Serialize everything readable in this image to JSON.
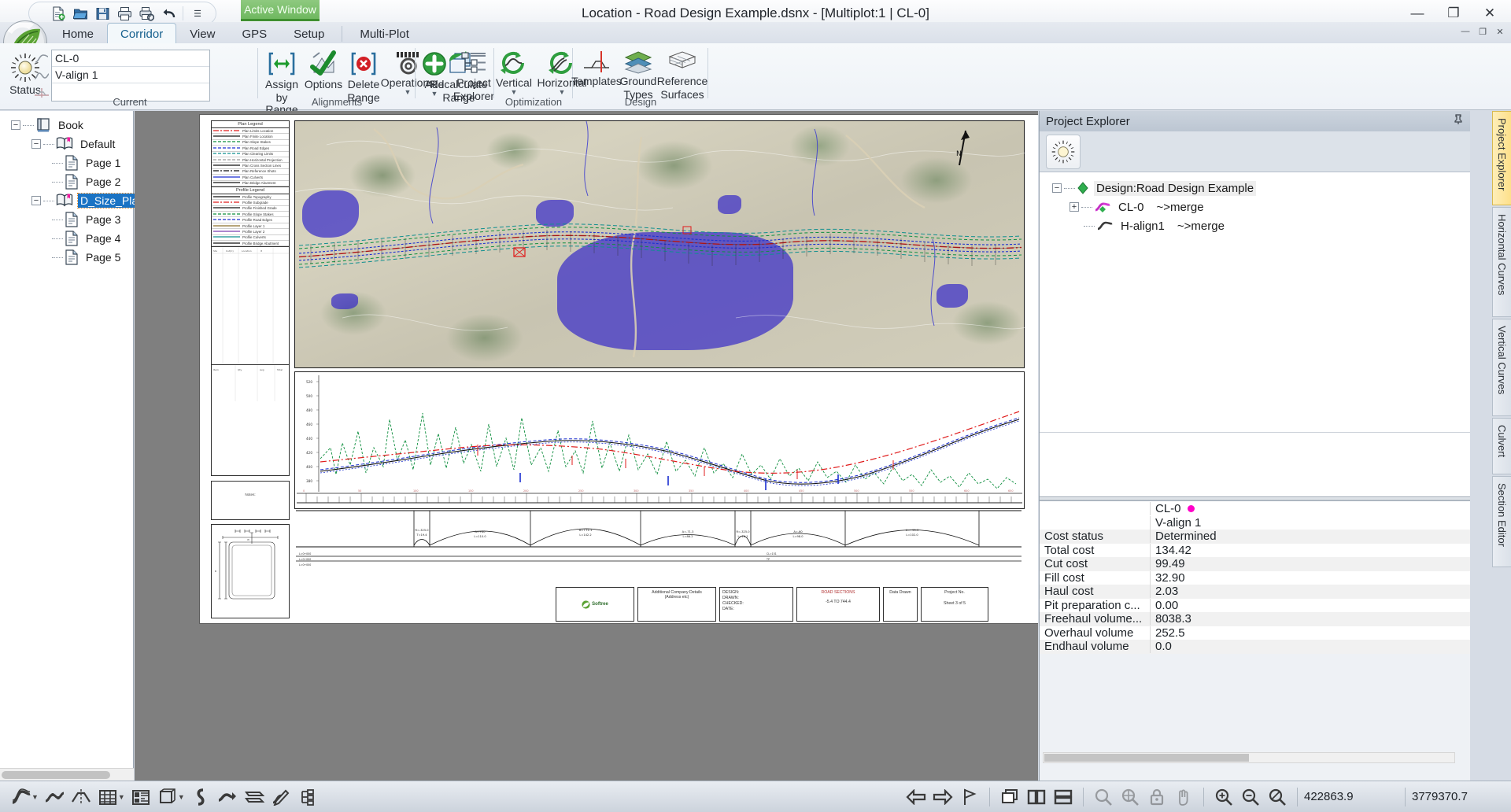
{
  "window": {
    "title": "Location - Road Design Example.dsnx - [Multiplot:1 | CL-0]",
    "active_window_badge": "Active Window",
    "minimize": "—",
    "maximize": "❐",
    "close": "✕",
    "doc_minimize": "—",
    "doc_restore": "❐",
    "doc_close": "✕"
  },
  "quick_access": {
    "items": [
      {
        "name": "new-icon",
        "glyph": "new"
      },
      {
        "name": "open-icon",
        "glyph": "open"
      },
      {
        "name": "save-icon",
        "glyph": "save"
      },
      {
        "name": "print-icon",
        "glyph": "print"
      },
      {
        "name": "print-setup-icon",
        "glyph": "print-setup"
      },
      {
        "name": "undo-icon",
        "glyph": "undo"
      }
    ],
    "overflow": "☰"
  },
  "tabs": [
    {
      "label": "Home",
      "active": false
    },
    {
      "label": "Corridor",
      "active": true
    },
    {
      "label": "View",
      "active": false
    },
    {
      "label": "GPS",
      "active": false
    },
    {
      "label": "Setup",
      "active": false
    },
    {
      "label": "Multi-Plot",
      "active": false
    }
  ],
  "ribbon": {
    "groups": [
      {
        "caption": "Current",
        "status_label": "Status",
        "fields": [
          {
            "name": "centerline-field",
            "value": "CL-0"
          },
          {
            "name": "valign-field",
            "value": "V-align 1"
          },
          {
            "name": "third-field",
            "value": ""
          }
        ]
      },
      {
        "caption": "Alignments",
        "buttons": [
          {
            "name": "assign-by-range-button",
            "line1": "Assign",
            "line2": "by Range",
            "icon": "assign-range-icon",
            "caret": false
          },
          {
            "name": "options-button",
            "line1": "Options",
            "line2": "",
            "icon": "options-check-icon",
            "caret": false
          },
          {
            "name": "delete-range-button",
            "line1": "Delete",
            "line2": "Range",
            "icon": "delete-range-icon",
            "caret": false
          },
          {
            "name": "operations-button",
            "line1": "Operations",
            "line2": "",
            "icon": "operations-gear-icon",
            "caret": true
          },
          {
            "name": "recalculate-range-button",
            "line1": "Recalculate",
            "line2": "Range",
            "icon": "recalculate-icon",
            "caret": false
          }
        ]
      },
      {
        "caption": "",
        "buttons": [
          {
            "name": "add-button",
            "line1": "Add",
            "line2": "",
            "icon": "add-plus-icon",
            "caret": true
          },
          {
            "name": "project-explorer-button",
            "line1": "Project",
            "line2": "Explorer",
            "icon": "project-explorer-icon",
            "caret": false
          }
        ]
      },
      {
        "caption": "Optimization",
        "buttons": [
          {
            "name": "vertical-optimize-button",
            "line1": "Vertical",
            "line2": "",
            "icon": "vertical-optimize-icon",
            "caret": true
          },
          {
            "name": "horizontal-optimize-button",
            "line1": "Horizontal",
            "line2": "",
            "icon": "horizontal-optimize-icon",
            "caret": true
          }
        ]
      },
      {
        "caption": "Design",
        "buttons": [
          {
            "name": "templates-button",
            "line1": "Templates",
            "line2": "",
            "icon": "templates-icon",
            "caret": false
          },
          {
            "name": "ground-types-button",
            "line1": "Ground",
            "line2": "Types",
            "icon": "ground-types-icon",
            "caret": false
          },
          {
            "name": "reference-surfaces-button",
            "line1": "Reference",
            "line2": "Surfaces",
            "icon": "reference-surfaces-icon",
            "caret": false
          }
        ]
      }
    ]
  },
  "tree": {
    "nodes": [
      {
        "label": "Book",
        "depth": 0,
        "icon": "book-icon",
        "expander": "−",
        "selected": false
      },
      {
        "label": "Default",
        "depth": 1,
        "icon": "open-book-icon",
        "expander": "−",
        "selected": false
      },
      {
        "label": "Page 1",
        "depth": 2,
        "icon": "page-icon",
        "expander": "",
        "selected": false
      },
      {
        "label": "Page 2",
        "depth": 2,
        "icon": "page-icon",
        "expander": "",
        "selected": false
      },
      {
        "label": "D_Size_Plan_Profi",
        "depth": 1,
        "icon": "open-book-icon",
        "expander": "−",
        "selected": true
      },
      {
        "label": "Page 3",
        "depth": 2,
        "icon": "page-icon",
        "expander": "",
        "selected": false
      },
      {
        "label": "Page 4",
        "depth": 2,
        "icon": "page-icon",
        "expander": "",
        "selected": false
      },
      {
        "label": "Page 5",
        "depth": 2,
        "icon": "page-icon",
        "expander": "",
        "selected": false
      }
    ]
  },
  "project_explorer": {
    "title": "Project Explorer",
    "pin_icon": "pin-icon",
    "sun_button": "sun-icon",
    "nodes": [
      {
        "label": "Design:Road Design Example",
        "depth": 0,
        "icon": "design-diamond-icon",
        "expander": "−",
        "selected": true,
        "suffix": ""
      },
      {
        "label": "CL-0",
        "depth": 1,
        "icon": "centerline-icon",
        "expander": "+",
        "selected": false,
        "suffix": "~>merge"
      },
      {
        "label": "H-align1",
        "depth": 1,
        "icon": "halign-icon",
        "expander": "",
        "selected": false,
        "suffix": "~>merge"
      }
    ]
  },
  "cost_table": {
    "header": {
      "col1": "",
      "col2_line1": "CL-0",
      "col2_line2": "V-align 1",
      "marker_color": "#ff00c8"
    },
    "rows": [
      {
        "key": "Cost status",
        "value": "Determined"
      },
      {
        "key": "Total cost",
        "value": "134.42"
      },
      {
        "key": "Cut cost",
        "value": "99.49"
      },
      {
        "key": "Fill cost",
        "value": "32.90"
      },
      {
        "key": "Haul cost",
        "value": "2.03"
      },
      {
        "key": "Pit preparation c...",
        "value": "0.00"
      },
      {
        "key": "Freehaul volume...",
        "value": "8038.3"
      },
      {
        "key": "Overhaul volume",
        "value": "252.5"
      },
      {
        "key": "Endhaul volume",
        "value": "0.0"
      }
    ]
  },
  "vertical_tabs": [
    {
      "label": "Project Explorer",
      "active": true
    },
    {
      "label": "Horizontal Curves",
      "active": false
    },
    {
      "label": "Vertical Curves",
      "active": false
    },
    {
      "label": "Culvert",
      "active": false
    },
    {
      "label": "Section Editor",
      "active": false
    }
  ],
  "drawing": {
    "plan_legend_title": "Plan Legend",
    "plan_legend_items": [
      {
        "label": "Plan Limits Location",
        "color": "#e01b1b",
        "style": "dashdot"
      },
      {
        "label": "Plan Finite Location",
        "color": "#111111",
        "style": "solid"
      },
      {
        "label": "Plan Slope Stakes",
        "color": "#0f8f3f",
        "style": "dashed"
      },
      {
        "label": "Plan Road Edges",
        "color": "#1b2fd0",
        "style": "dashed"
      },
      {
        "label": "Plan Clearing Limits",
        "color": "#0f8f8f",
        "style": "dashed"
      },
      {
        "label": "Plan Horizontal Projection",
        "color": "#999999",
        "style": "dashed"
      },
      {
        "label": "Plan Cross Section Lines",
        "color": "#111111",
        "style": "solid"
      },
      {
        "label": "Plan Reference Shots",
        "color": "#111111",
        "style": "dashdot"
      },
      {
        "label": "Plan Culverts",
        "color": "#1b2fd0",
        "style": "solid"
      },
      {
        "label": "Plan Bridge Abutment",
        "color": "#111111",
        "style": "solid"
      }
    ],
    "profile_legend_title": "Profile Legend",
    "profile_legend_items": [
      {
        "label": "Profile Topography",
        "color": "#111111",
        "style": "solid"
      },
      {
        "label": "Profile Subgrade",
        "color": "#e01b1b",
        "style": "dashdot"
      },
      {
        "label": "Profile Finished Grade",
        "color": "#111111",
        "style": "solid"
      },
      {
        "label": "Profile Slope Stakes",
        "color": "#0f8f3f",
        "style": "dashed"
      },
      {
        "label": "Profile Road Edges",
        "color": "#1b2fd0",
        "style": "dashed"
      },
      {
        "label": "Profile Layer 1",
        "color": "#8a6f2a",
        "style": "solid"
      },
      {
        "label": "Profile Layer 2",
        "color": "#7a3fb0",
        "style": "solid"
      },
      {
        "label": "Profile Culverts",
        "color": "#0f8f8f",
        "style": "solid"
      },
      {
        "label": "Profile Bridge Abutment",
        "color": "#111111",
        "style": "solid"
      }
    ],
    "notes_label": "Notes:",
    "titleblocks": [
      {
        "name": "logo-block",
        "lines": [
          "Softree"
        ]
      },
      {
        "name": "company-block",
        "lines": [
          "Additional Company Details",
          "(Address etc)"
        ]
      },
      {
        "name": "signoff-block",
        "lines": [
          "DESIGN:",
          "DRAWN:",
          "CHECKED:",
          "DATE:"
        ]
      },
      {
        "name": "sections-block",
        "lines": [
          "ROAD SECTIONS",
          "-5.4      TO     744.4"
        ]
      },
      {
        "name": "datadrawn-block",
        "lines": [
          "Data Drawn"
        ]
      },
      {
        "name": "sheet-block",
        "lines": [
          "Project No.",
          "Sheet 3 of 5"
        ]
      }
    ],
    "station_from": "-5.4",
    "station_to": "744.4",
    "sheet_label": "Sheet 3 of 5",
    "north_arrow": "north-arrow-icon"
  },
  "statusbar": {
    "left_tools": [
      {
        "name": "alignment-tool",
        "icon": "alignment-curve-icon",
        "caret": true,
        "disabled": false
      },
      {
        "name": "profile-tool",
        "icon": "profile-curve-icon",
        "caret": false,
        "disabled": false
      },
      {
        "name": "cross-section-tool",
        "icon": "cross-section-icon",
        "caret": false,
        "disabled": false
      },
      {
        "name": "table-tool",
        "icon": "table-grid-icon",
        "caret": true,
        "disabled": false
      },
      {
        "name": "report-tool",
        "icon": "report-layout-icon",
        "caret": false,
        "disabled": false
      },
      {
        "name": "3d-view-tool",
        "icon": "cube-3d-icon",
        "caret": true,
        "disabled": false
      },
      {
        "name": "insert-pi-tool",
        "icon": "insert-pi-icon",
        "caret": false,
        "disabled": false
      },
      {
        "name": "move-pi-tool",
        "icon": "move-pi-icon",
        "caret": false,
        "disabled": false
      },
      {
        "name": "offset-tool",
        "icon": "offset-icon",
        "caret": false,
        "disabled": false
      },
      {
        "name": "edit-alignment-tool",
        "icon": "edit-alignment-icon",
        "caret": false,
        "disabled": false
      },
      {
        "name": "hierarchy-tool",
        "icon": "hierarchy-icon",
        "caret": false,
        "disabled": false
      }
    ],
    "right_tools": [
      {
        "name": "previous-button",
        "icon": "arrow-left-icon",
        "disabled": false
      },
      {
        "name": "next-button",
        "icon": "arrow-right-icon",
        "disabled": false
      },
      {
        "name": "flag-button",
        "icon": "flag-icon",
        "disabled": false
      },
      {
        "name": "cascade-windows-button",
        "icon": "cascade-windows-icon",
        "disabled": false
      },
      {
        "name": "tile-vertical-button",
        "icon": "tile-vertical-icon",
        "disabled": false
      },
      {
        "name": "tile-horizontal-button",
        "icon": "tile-horizontal-icon",
        "disabled": false
      },
      {
        "name": "zoom-window-button",
        "icon": "magnifier-icon",
        "disabled": true
      },
      {
        "name": "zoom-extents-button",
        "icon": "magnifier-target-icon",
        "disabled": true
      },
      {
        "name": "lock-zoom-button",
        "icon": "lock-icon",
        "disabled": true
      },
      {
        "name": "pan-button",
        "icon": "hand-icon",
        "disabled": true
      },
      {
        "name": "zoom-in-button",
        "icon": "magnifier-plus-icon",
        "disabled": false
      },
      {
        "name": "zoom-out-button",
        "icon": "magnifier-minus-icon",
        "disabled": false
      },
      {
        "name": "zoom-reset-button",
        "icon": "magnifier-slash-icon",
        "disabled": false
      }
    ],
    "coord_x": "422863.9",
    "coord_y": "3779370.7"
  }
}
